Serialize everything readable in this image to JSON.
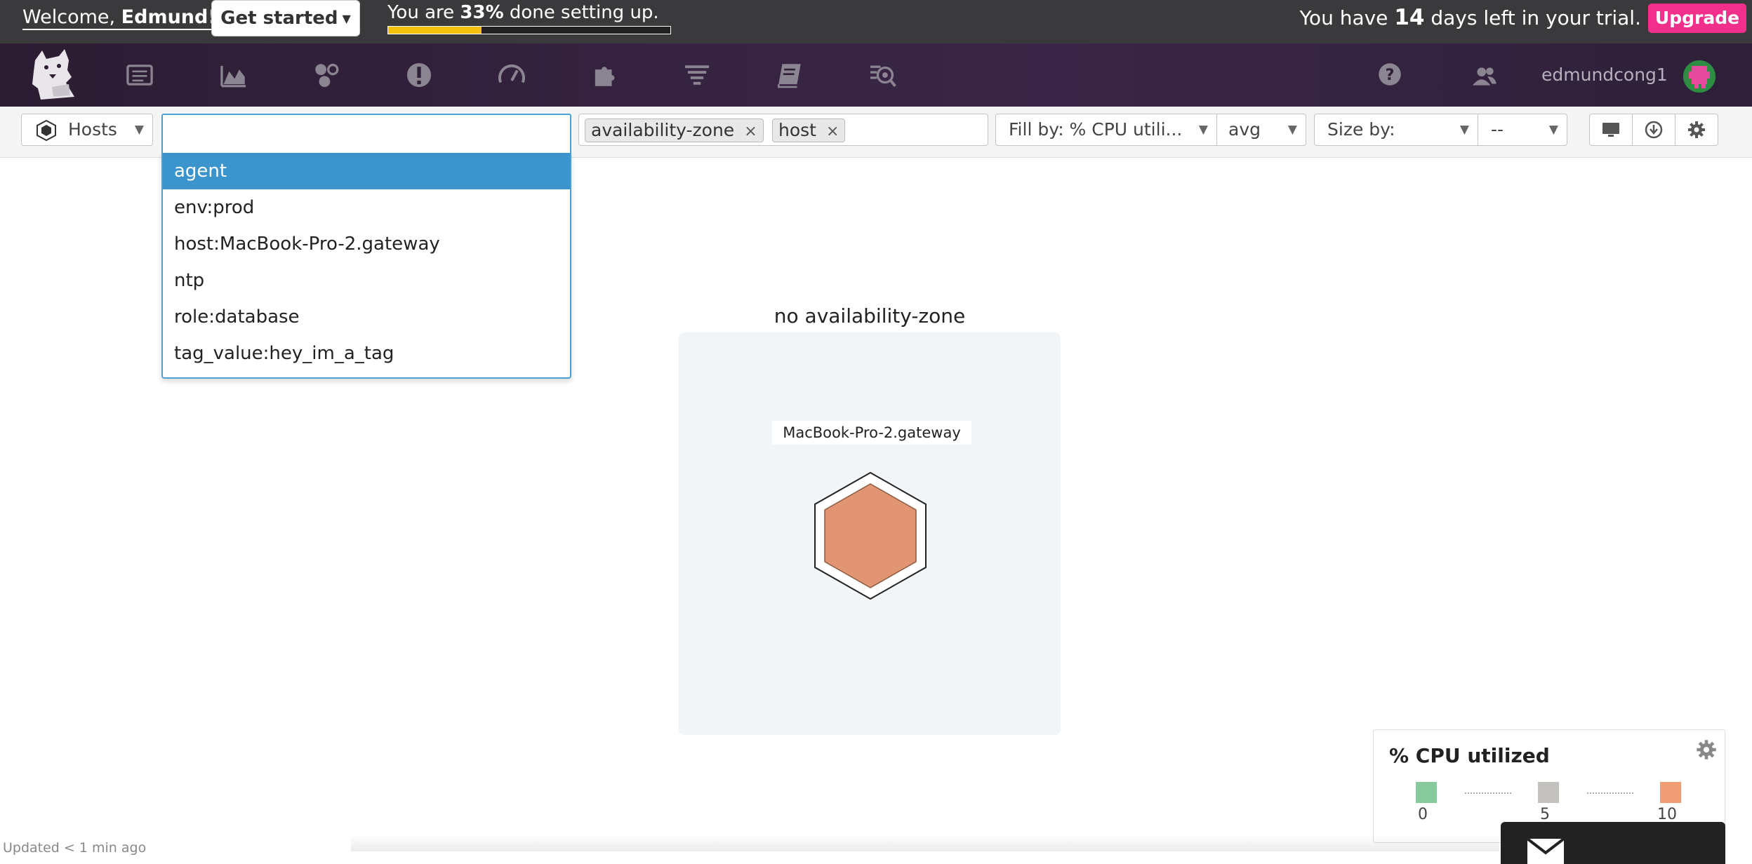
{
  "banner": {
    "welcome_prefix": "Welcome, ",
    "welcome_name": "Edmund!",
    "get_started": "Get started",
    "setup_prefix": "You are ",
    "setup_percent": "33%",
    "setup_suffix": " done setting up.",
    "progress": 0.33,
    "trial_prefix": "You have ",
    "trial_days": "14",
    "trial_suffix": " days left in your trial.",
    "upgrade": "Upgrade"
  },
  "nav": {
    "items": [
      "events-icon",
      "metrics-icon",
      "infrastructure-icon",
      "monitors-icon",
      "dashboards-icon",
      "integrations-icon",
      "logs-icon",
      "notebooks-icon",
      "watchdog-icon"
    ],
    "username": "edmundcong1"
  },
  "toolbar": {
    "hosts": "Hosts",
    "search_value": "",
    "tags": [
      "availability-zone",
      "host"
    ],
    "fill_by": "Fill by: % CPU utili...",
    "agg": "avg",
    "size_by": "Size by:",
    "size_value": "--"
  },
  "dropdown": {
    "items": [
      "agent",
      "env:prod",
      "host:MacBook-Pro-2.gateway",
      "ntp",
      "role:database",
      "tag_value:hey_im_a_tag"
    ],
    "active_index": 0
  },
  "map": {
    "group_title": "no availability-zone",
    "host": "MacBook-Pro-2.gateway",
    "host_color": "#e29572"
  },
  "legend": {
    "title": "% CPU utilized",
    "stops": [
      {
        "label": "0",
        "color": "#86c99a"
      },
      {
        "label": "5",
        "color": "#c3c2be"
      },
      {
        "label": "10",
        "color": "#f09d76"
      }
    ]
  },
  "footer": {
    "updated": "Updated < 1 min ago"
  }
}
